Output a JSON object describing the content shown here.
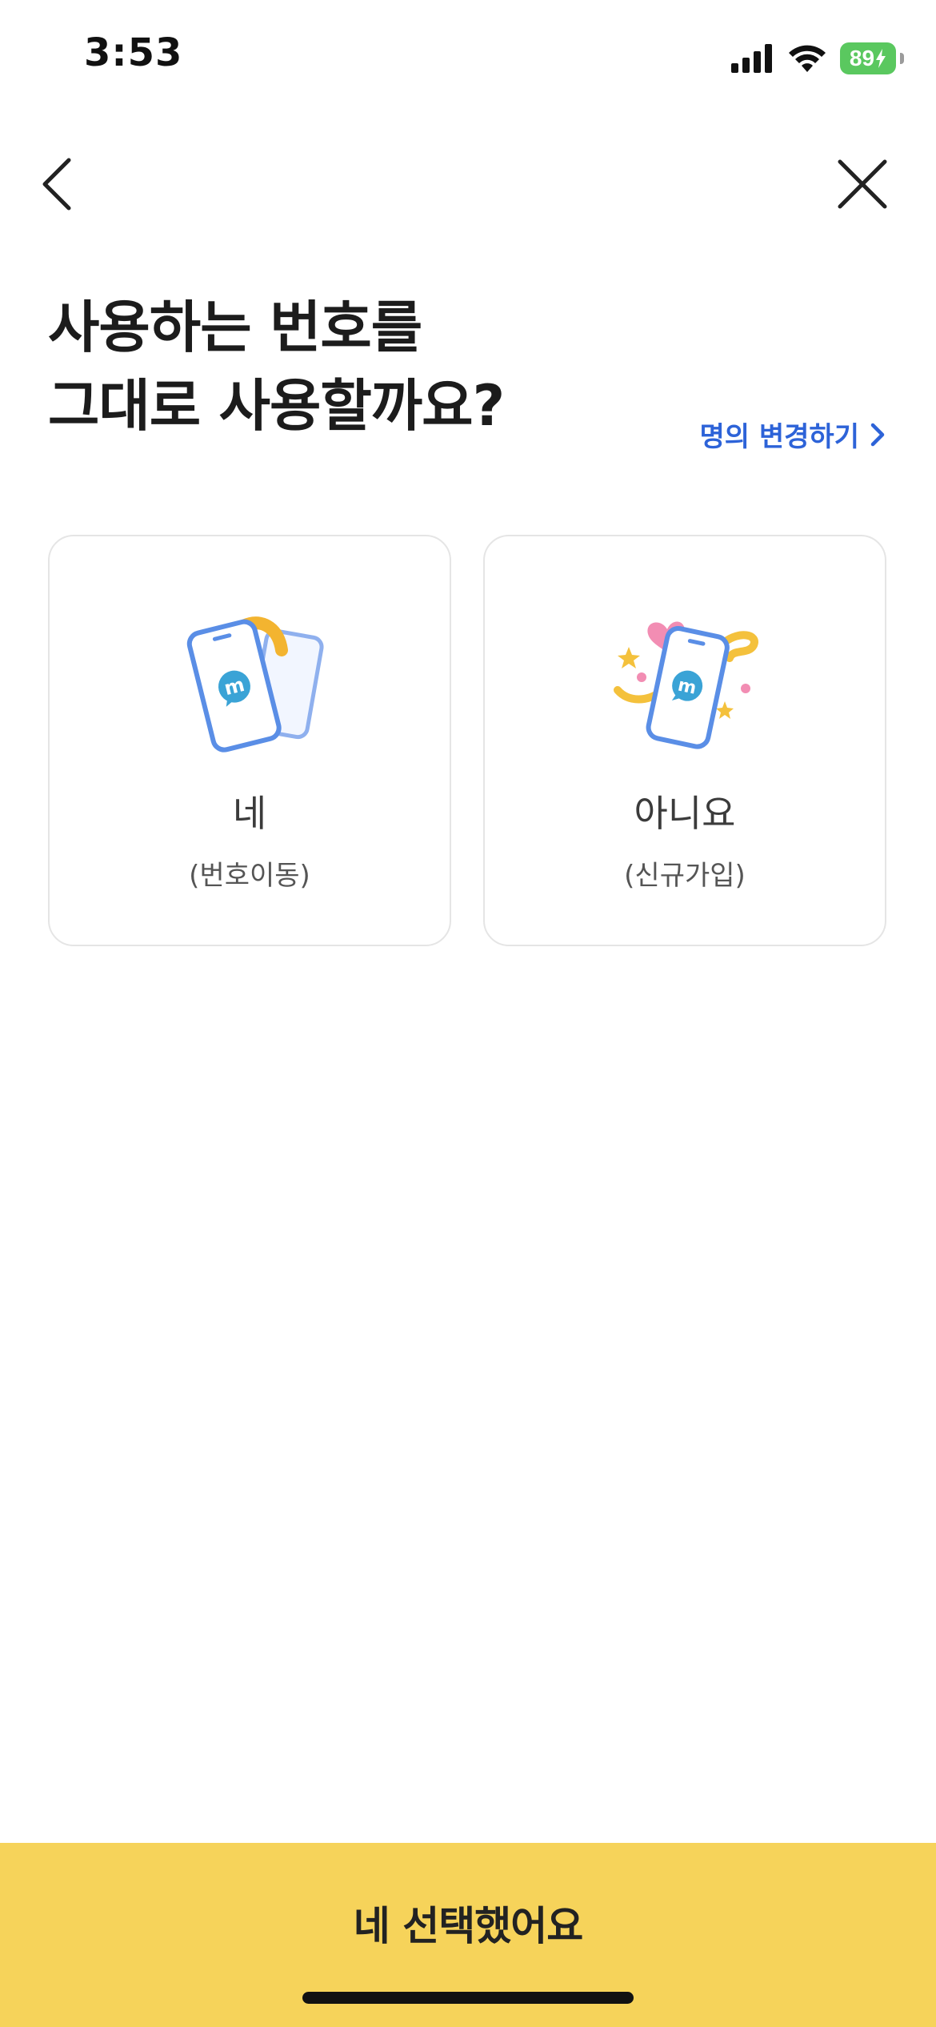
{
  "status_bar": {
    "time": "3:53",
    "battery_level": "89",
    "battery_color": "#5ac85f",
    "icons": [
      "cellular-signal-icon",
      "wifi-icon",
      "battery-charging-icon"
    ]
  },
  "nav": {
    "back_icon": "chevron-left-icon",
    "close_icon": "close-icon"
  },
  "page": {
    "title_line1": "사용하는 번호를",
    "title_line2": "그대로 사용할까요?",
    "name_change_label": "명의 변경하기",
    "name_change_icon": "chevron-right-icon",
    "link_color": "#2d63d8"
  },
  "options": [
    {
      "title": "네",
      "subtitle": "(번호이동)",
      "icon": "phone-transfer-icon"
    },
    {
      "title": "아니요",
      "subtitle": "(신규가입)",
      "icon": "new-phone-celebration-icon"
    }
  ],
  "confirm": {
    "label": "네 선택했어요",
    "color": "#f6d35a"
  }
}
